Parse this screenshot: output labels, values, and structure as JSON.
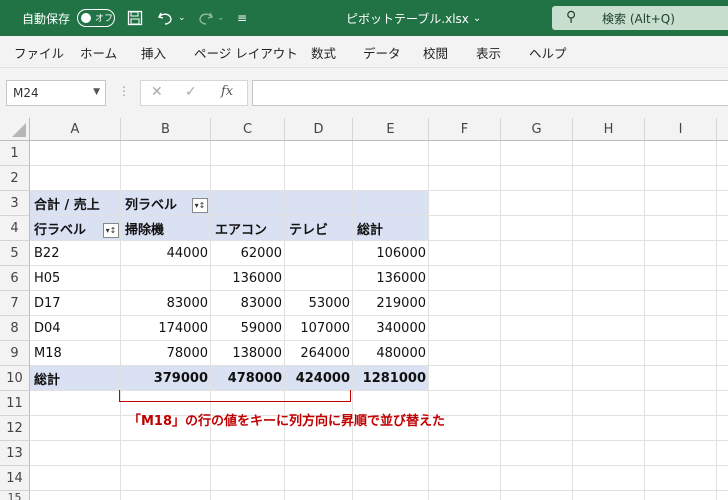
{
  "titlebar": {
    "autosave_label": "自動保存",
    "autosave_state": "オフ",
    "filename": "ピボットテーブル.xlsx",
    "search_placeholder": "検索 (Alt+Q)"
  },
  "menu": [
    "ファイル",
    "ホーム",
    "挿入",
    "ページ レイアウト",
    "数式",
    "データ",
    "校閲",
    "表示",
    "ヘルプ"
  ],
  "formula_bar": {
    "name_box": "M24",
    "fx": "fx",
    "cancel": "✕",
    "enter": "✓",
    "formula": ""
  },
  "columns": [
    "A",
    "B",
    "C",
    "D",
    "E",
    "F",
    "G",
    "H",
    "I"
  ],
  "rows": [
    "1",
    "2",
    "3",
    "4",
    "5",
    "6",
    "7",
    "8",
    "9",
    "10",
    "11",
    "12",
    "13",
    "14",
    "15"
  ],
  "pivot": {
    "row3": {
      "a": "合計 / 売上",
      "b": "列ラベル"
    },
    "row4": {
      "a": "行ラベル",
      "b": "掃除機",
      "c": "エアコン",
      "d": "テレビ",
      "e": "総計"
    },
    "data": [
      {
        "a": "B22",
        "b": "44000",
        "c": "62000",
        "d": "",
        "e": "106000"
      },
      {
        "a": "H05",
        "b": "",
        "c": "136000",
        "d": "",
        "e": "136000"
      },
      {
        "a": "D17",
        "b": "83000",
        "c": "83000",
        "d": "53000",
        "e": "219000"
      },
      {
        "a": "D04",
        "b": "174000",
        "c": "59000",
        "d": "107000",
        "e": "340000"
      },
      {
        "a": "M18",
        "b": "78000",
        "c": "138000",
        "d": "264000",
        "e": "480000"
      }
    ],
    "total": {
      "a": "総計",
      "b": "379000",
      "c": "478000",
      "d": "424000",
      "e": "1281000"
    }
  },
  "annotation": "「M18」の行の値をキーに列方向に昇順で並び替えた"
}
